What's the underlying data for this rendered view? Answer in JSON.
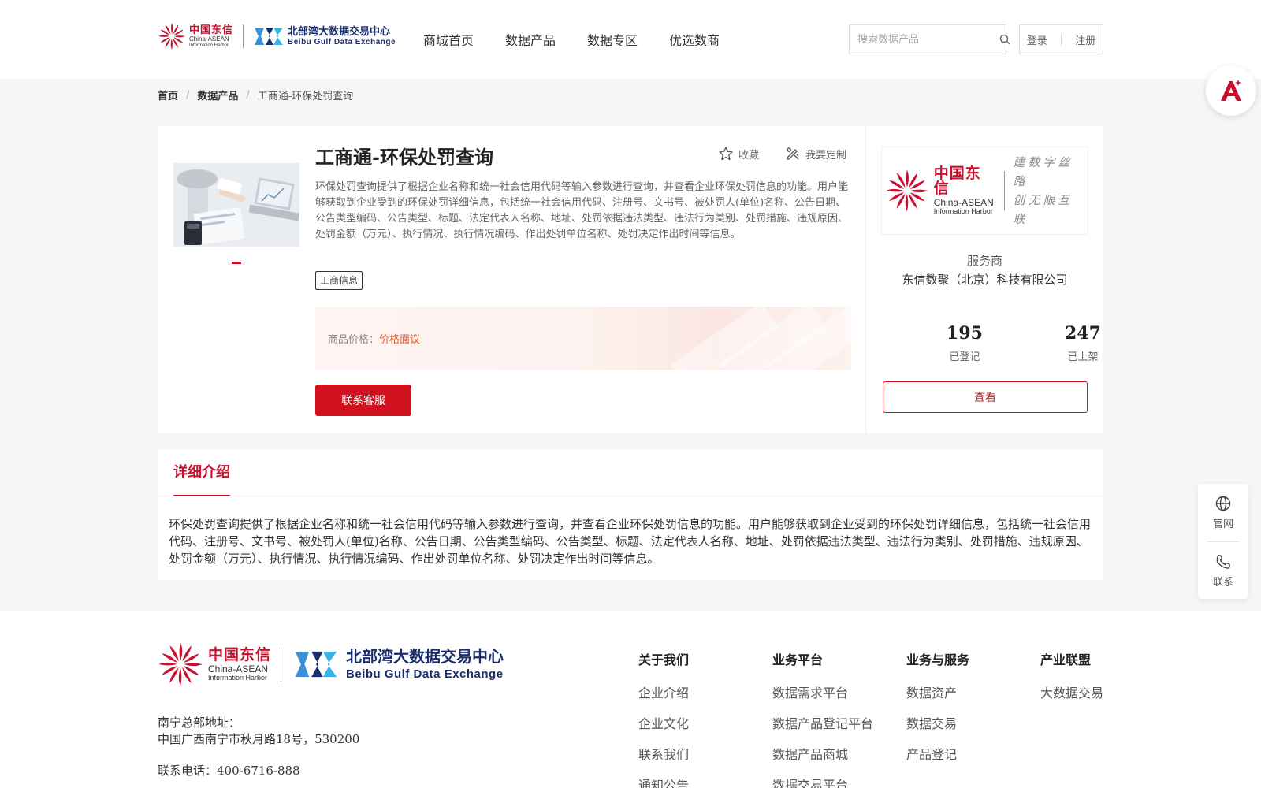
{
  "header": {
    "brand_cn": "中国东信",
    "brand_en1": "China-ASEAN",
    "brand_en2": "Information Harbor",
    "partner_cn": "北部湾大数据交易中心",
    "partner_en": "Beibu Gulf Data Exchange",
    "nav": [
      "商城首页",
      "数据产品",
      "数据专区",
      "优选数商"
    ],
    "search_placeholder": "搜索数据产品",
    "login": "登录",
    "register": "注册"
  },
  "breadcrumb": {
    "home": "首页",
    "section": "数据产品",
    "current": "工商通-环保处罚查询"
  },
  "product": {
    "title": "工商通-环保处罚查询",
    "favorite": "收藏",
    "customize": "我要定制",
    "description": "环保处罚查询提供了根据企业名称和统一社会信用代码等输入参数进行查询，并查看企业环保处罚信息的功能。用户能够获取到企业受到的环保处罚详细信息，包括统一社会信用代码、注册号、文书号、被处罚人(单位)名称、公告日期、公告类型编码、公告类型、标题、法定代表人名称、地址、处罚依据违法类型、违法行为类别、处罚措施、违规原因、处罚金额（万元）、执行情况、执行情况编码、作出处罚单位名称、处罚决定作出时间等信息。",
    "tag": "工商信息",
    "price_label": "商品价格：",
    "price_value": "价格面议",
    "contact_button": "联系客服"
  },
  "provider": {
    "logo_cn": "中国东信",
    "logo_en1": "China-ASEAN",
    "logo_en2": "Information Harbor",
    "slogan1": "建数字丝路",
    "slogan2": "创无限互联",
    "label": "服务商",
    "name": "东信数聚（北京）科技有限公司",
    "registered_count": "195",
    "registered_label": "已登记",
    "listed_count": "247",
    "listed_label": "已上架",
    "view_button": "查看"
  },
  "detail": {
    "tab": "详细介绍",
    "text": "环保处罚查询提供了根据企业名称和统一社会信用代码等输入参数进行查询，并查看企业环保处罚信息的功能。用户能够获取到企业受到的环保处罚详细信息，包括统一社会信用代码、注册号、文书号、被处罚人(单位)名称、公告日期、公告类型编码、公告类型、标题、法定代表人名称、地址、处罚依据违法类型、违法行为类别、处罚措施、违规原因、处罚金额（万元）、执行情况、执行情况编码、作出处罚单位名称、处罚决定作出时间等信息。"
  },
  "side_panel": {
    "website": "官网",
    "contact": "联系"
  },
  "footer": {
    "brand_cn": "中国东信",
    "brand_en1": "China-ASEAN",
    "brand_en2": "Information Harbor",
    "partner_cn": "北部湾大数据交易中心",
    "partner_en": "Beibu Gulf Data Exchange",
    "address_label": "南宁总部地址：",
    "address": "中国广西南宁市秋月路18号，530200",
    "phone": "联系电话：400-6716-888",
    "columns": [
      {
        "title": "关于我们",
        "items": [
          "企业介绍",
          "企业文化",
          "联系我们",
          "通知公告"
        ]
      },
      {
        "title": "业务平台",
        "items": [
          "数据需求平台",
          "数据产品登记平台",
          "数据产品商城",
          "数据交易平台"
        ]
      },
      {
        "title": "业务与服务",
        "items": [
          "数据资产",
          "数据交易",
          "产品登记"
        ]
      },
      {
        "title": "产业联盟",
        "items": [
          "大数据交易"
        ]
      }
    ]
  },
  "colors": {
    "accent": "#c8102e",
    "partner_blue": "#1a2e6e"
  }
}
